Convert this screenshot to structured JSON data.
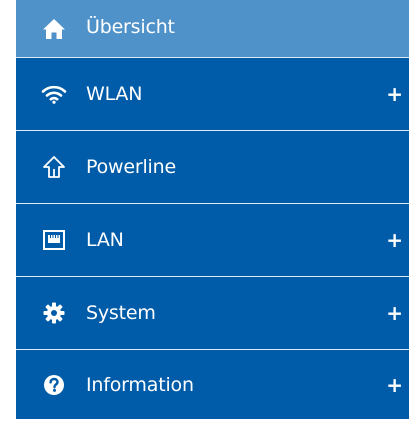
{
  "nav": {
    "items": [
      {
        "label": "Übersicht",
        "icon": "home-icon",
        "expandable": false,
        "active": true
      },
      {
        "label": "WLAN",
        "icon": "wifi-icon",
        "expandable": true,
        "active": false
      },
      {
        "label": "Powerline",
        "icon": "powerline-icon",
        "expandable": false,
        "active": false
      },
      {
        "label": "LAN",
        "icon": "lan-port-icon",
        "expandable": true,
        "active": false
      },
      {
        "label": "System",
        "icon": "gear-icon",
        "expandable": true,
        "active": false
      },
      {
        "label": "Information",
        "icon": "question-icon",
        "expandable": true,
        "active": false
      }
    ],
    "expand_symbol": "+"
  },
  "colors": {
    "nav_background": "#005ca8",
    "active_background": "#4f92c9",
    "text": "#ffffff",
    "divider": "#dfe9f3"
  }
}
